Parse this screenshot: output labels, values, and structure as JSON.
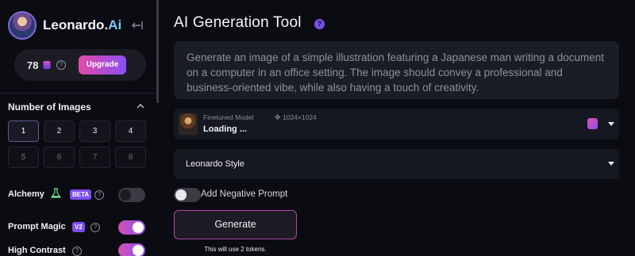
{
  "brand": {
    "name_main": "Leonardo.",
    "name_accent": "Ai"
  },
  "account": {
    "tokens": "78",
    "upgrade_label": "Upgrade"
  },
  "sidebar": {
    "images_section_title": "Number of Images",
    "image_counts": [
      "1",
      "2",
      "3",
      "4",
      "5",
      "6",
      "7",
      "8"
    ],
    "selected_count": "1",
    "settings": [
      {
        "label": "Alchemy",
        "badge": "BETA",
        "enabled": false
      },
      {
        "label": "Prompt Magic",
        "badge": "V2",
        "enabled": true
      },
      {
        "label": "High Contrast",
        "badge": "",
        "enabled": true
      }
    ]
  },
  "main": {
    "title": "AI Generation Tool",
    "prompt_placeholder": "Generate an image of a simple illustration featuring a Japanese man writing a document on a computer in an office setting. The image should convey a professional and business-oriented vibe, while also having a touch of creativity.",
    "model": {
      "kicker": "Finetuned Model",
      "size": "1024×1024",
      "name": "Loading ..."
    },
    "style": {
      "value": "Leonardo Style"
    },
    "negative_prompt": {
      "label": "Add Negative Prompt",
      "enabled": false
    },
    "generate": {
      "label": "Generate",
      "note": "This will use 2 tokens."
    }
  },
  "colors": {
    "accent_pink": "#e34ba9",
    "accent_purple": "#8b4ef3",
    "background": "#0b0c12"
  },
  "icons": [
    "avatar",
    "collapse-sidebar-icon",
    "coin-icon",
    "help-icon",
    "chevron-up-icon",
    "sparkle-icon",
    "edit-icon",
    "caret-down-icon",
    "resize-icon"
  ]
}
